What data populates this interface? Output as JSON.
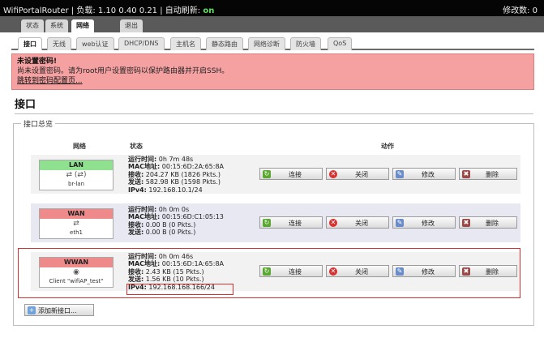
{
  "topbar": {
    "brand": "WifiPortalRouter | 负载: 1.10 0.40 0.21 | 自动刷新: ",
    "refresh_state": "on",
    "changes": "修改数: 0"
  },
  "menu": {
    "status": "状态",
    "system": "系统",
    "network": "网络",
    "logout": "退出"
  },
  "subtabs": [
    "接口",
    "无线",
    "web认证",
    "DHCP/DNS",
    "主机名",
    "静态路由",
    "网络诊断",
    "防火墙",
    "QoS"
  ],
  "alert": {
    "title": "未设置密码!",
    "message": "尚未设置密码。请为root用户设置密码以保护路由器并开启SSH。",
    "link": "跳转到密码配置页..."
  },
  "page_title": "接口",
  "section_title": "接口总览",
  "columns": {
    "network": "网络",
    "status": "状态",
    "actions": "动作"
  },
  "actions": {
    "connect": "连接",
    "close": "关闭",
    "edit": "修改",
    "delete": "删除"
  },
  "labels": {
    "uptime": "运行时间:",
    "mac": "MAC地址:",
    "rx": "接收:",
    "tx": "发送:",
    "ipv4": "IPv4:"
  },
  "interfaces": [
    {
      "name": "LAN",
      "icons": "⇄ (⇄)",
      "device": "br-lan",
      "uptime": " 0h 7m 48s",
      "mac": " 00:15:6D:2A:65:8A",
      "rx": " 204.27 KB (1826 Pkts.)",
      "tx": " 582.98 KB (1598 Pkts.)",
      "ipv4": " 192.168.10.1/24",
      "color": "#8fe08f"
    },
    {
      "name": "WAN",
      "icons": "⇄",
      "device": "eth1",
      "uptime": " 0h 0m 0s",
      "mac": " 00:15:6D:C1:05:13",
      "rx": " 0.00 B (0 Pkts.)",
      "tx": " 0.00 B (0 Pkts.)",
      "color": "#ef8a8a"
    },
    {
      "name": "WWAN",
      "icons": "◉",
      "device": "Client \"wifiAP_test\"",
      "uptime": " 0h 0m 46s",
      "mac": " 00:15:6D:1A:65:8A",
      "rx": " 2.43 KB (15 Pkts.)",
      "tx": " 1.56 KB (10 Pkts.)",
      "ipv4": " 192.168.168.166/24",
      "color": "#ef8a8a"
    }
  ],
  "add_button": "添加新接口..."
}
